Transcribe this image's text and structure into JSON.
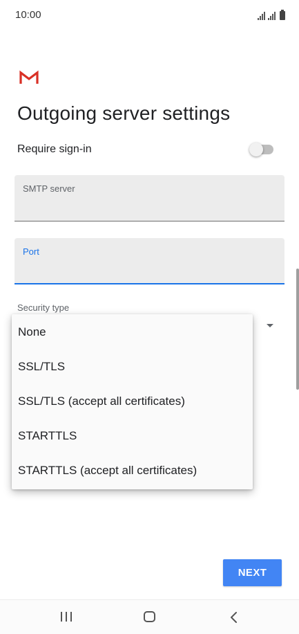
{
  "status_bar": {
    "time": "10:00",
    "icons": [
      "signal-icon",
      "signal-icon",
      "battery-icon"
    ]
  },
  "app": {
    "logo_icon": "gmail-icon",
    "logo_colors": [
      "#d93025",
      "#c5221f"
    ]
  },
  "page": {
    "title": "Outgoing server settings"
  },
  "require_signin": {
    "label": "Require sign-in",
    "enabled": false
  },
  "fields": {
    "smtp_server": {
      "label": "SMTP server",
      "value": ""
    },
    "port": {
      "label": "Port",
      "value": "",
      "focused": true
    }
  },
  "security_type": {
    "label": "Security type",
    "options": [
      "None",
      "SSL/TLS",
      "SSL/TLS (accept all certificates)",
      "STARTTLS",
      "STARTTLS (accept all certificates)"
    ]
  },
  "actions": {
    "next_label": "NEXT"
  },
  "colors": {
    "accent": "#1a73e8",
    "button": "#4285f4",
    "field_bg": "#ececec"
  },
  "nav_bar": {
    "icons": [
      "recent-apps-icon",
      "home-icon",
      "back-icon"
    ]
  }
}
